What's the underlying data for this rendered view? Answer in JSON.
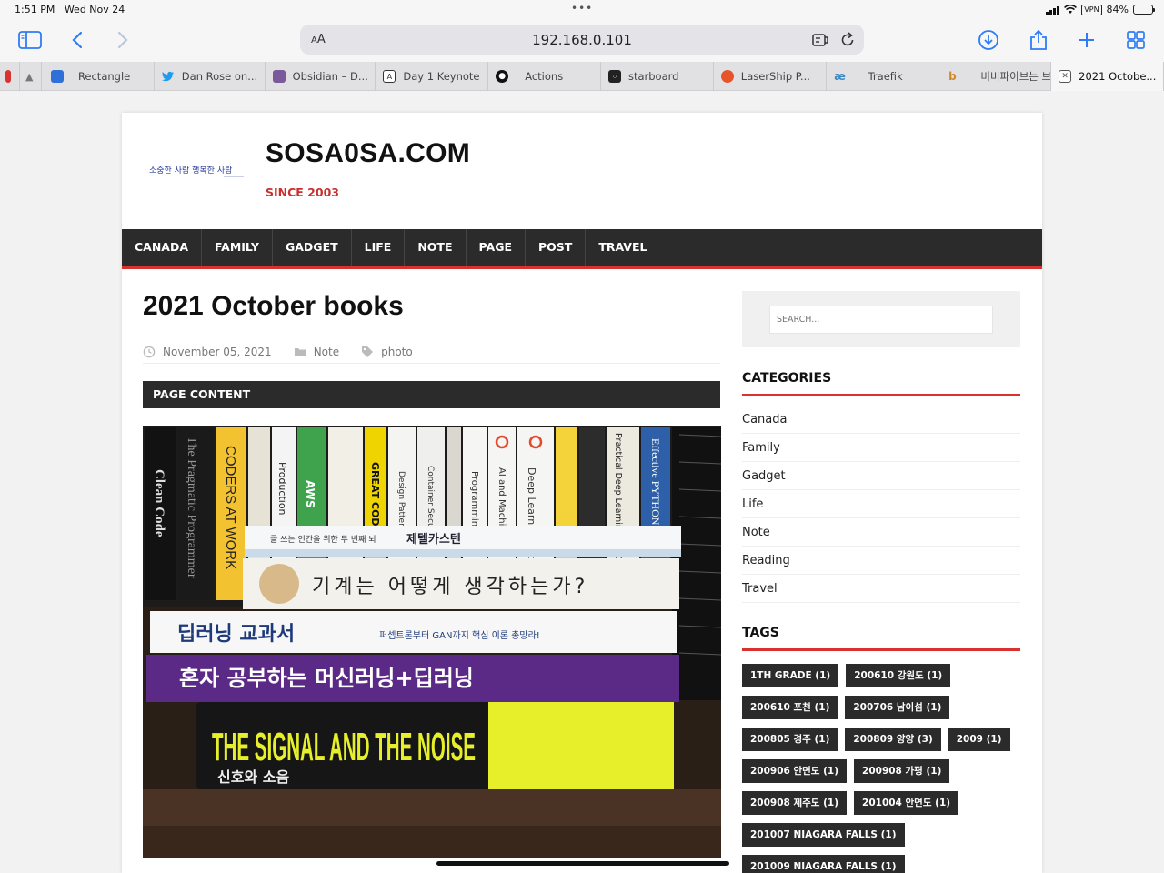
{
  "status_bar": {
    "time": "1:51 PM",
    "date": "Wed Nov 24",
    "battery": "84%",
    "battery_level": 0.84,
    "vpn": "VPN"
  },
  "browser": {
    "url": "192.168.0.101",
    "aa_small": "A",
    "aa_large": "A",
    "tabs": [
      {
        "label": "",
        "icon": "red-app-icon"
      },
      {
        "label": "",
        "icon": "pin-icon"
      },
      {
        "label": "Rectangle",
        "icon": "rectangle-app-icon"
      },
      {
        "label": "Dan Rose on...",
        "icon": "twitter-bird-icon"
      },
      {
        "label": "Obsidian – D...",
        "icon": "obsidian-icon"
      },
      {
        "label": "Day 1 Keynote",
        "icon": "keynote-a-icon"
      },
      {
        "label": "Actions",
        "icon": "github-icon"
      },
      {
        "label": "starboard",
        "icon": "starboard-icon"
      },
      {
        "label": "LaserShip P...",
        "icon": "lasership-icon"
      },
      {
        "label": "Traefik",
        "icon": "traefik-icon"
      },
      {
        "label": "비비파이브는 브...",
        "icon": "b-icon"
      },
      {
        "label": "2021 Octobe...",
        "icon": "close-icon"
      }
    ]
  },
  "site": {
    "logo_text": "소중한 사람 행복한 사람",
    "title": "SOSA0SA.COM",
    "tagline": "SINCE 2003",
    "nav": [
      "CANADA",
      "FAMILY",
      "GADGET",
      "LIFE",
      "NOTE",
      "PAGE",
      "POST",
      "TRAVEL"
    ]
  },
  "post": {
    "title": "2021 October books",
    "date": "November 05, 2021",
    "category": "Note",
    "tag": "photo",
    "section": "PAGE CONTENT",
    "books": {
      "spines": [
        "Clean Code",
        "The Pragmatic Programmer",
        "CODERS AT WORK",
        "Production",
        "AWS",
        "GREAT CODE",
        "Design Patterns",
        "Container Security",
        "Programming",
        "AI and Machine",
        "Deep Learning with fastai",
        "Practical Deep Learning for Cloud, Mobile & Edge",
        "Effective PYTHON"
      ],
      "stack": [
        {
          "title": "제텔카스텐",
          "sub": "글 쓰는 인간을 위한 두 번째 뇌"
        },
        {
          "title": "기계는 어떻게 생각하는가?"
        },
        {
          "title": "딥러닝 교과서",
          "sub": "퍼셉트론부터 GAN까지 핵심 이론 총망라!"
        },
        {
          "title": "혼자 공부하는 머신러닝+딥러닝"
        },
        {
          "title": "THE SIGNAL AND THE NOISE",
          "sub": "신호와 소음"
        }
      ]
    }
  },
  "sidebar": {
    "search_placeholder": "SEARCH...",
    "categories_title": "CATEGORIES",
    "categories": [
      "Canada",
      "Family",
      "Gadget",
      "Life",
      "Note",
      "Reading",
      "Travel"
    ],
    "tags_title": "TAGS",
    "tags": [
      "1TH GRADE (1)",
      "200610 강원도 (1)",
      "200610 포천 (1)",
      "200706 남이섬 (1)",
      "200805 경주 (1)",
      "200809 양양 (3)",
      "2009 (1)",
      "200906 안면도 (1)",
      "200908 가평 (1)",
      "200908 제주도 (1)",
      "201004 안면도 (1)",
      "201007 NIAGARA FALLS (1)",
      "201009 NIAGARA FALLS (1)"
    ]
  },
  "colors": {
    "accent": "#d9312d",
    "nav_bg": "#2b2b2b",
    "link_blue": "#2f7cf6"
  }
}
